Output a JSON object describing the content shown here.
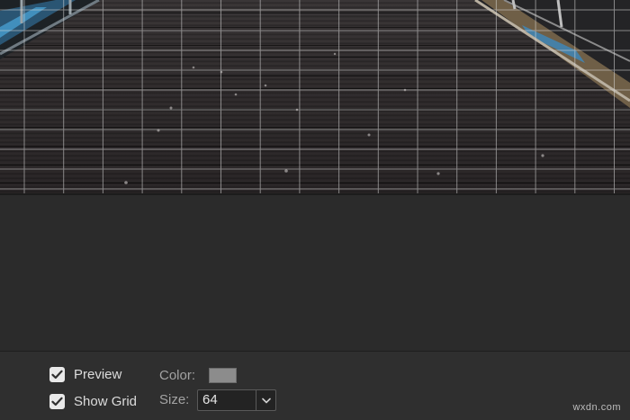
{
  "options": {
    "preview": {
      "label": "Preview",
      "checked": true
    },
    "show_grid": {
      "label": "Show Grid",
      "checked": true
    },
    "color": {
      "label": "Color:",
      "value": "#8c8c8c"
    },
    "size": {
      "label": "Size:",
      "value": "64"
    }
  },
  "watermark": "wxdn.com",
  "colors": {
    "panel_background": "#2f2f2f",
    "canvas_background": "#2b2b2b",
    "grid_line": "#d9d9d9"
  }
}
